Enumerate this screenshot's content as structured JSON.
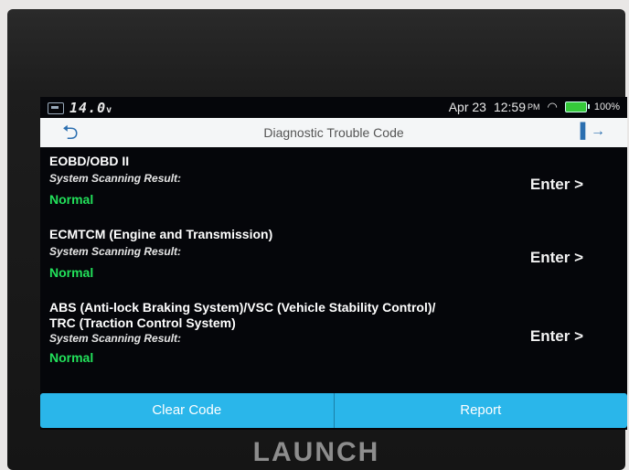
{
  "statusbar": {
    "voltage": "14.0",
    "voltage_unit": "v",
    "date": "Apr 23",
    "time": "12:59",
    "ampm": "PM",
    "battery": "100%"
  },
  "titlebar": {
    "title": "Diagnostic Trouble Code"
  },
  "systems": [
    {
      "name_line1": "EOBD/OBD II",
      "name_line2": "",
      "scan_label": "System Scanning Result:",
      "status": "Normal",
      "enter_label": "Enter >"
    },
    {
      "name_line1": "ECMTCM (Engine and Transmission)",
      "name_line2": "",
      "scan_label": "System Scanning Result:",
      "status": "Normal",
      "enter_label": "Enter >"
    },
    {
      "name_line1": "ABS (Anti-lock Braking System)/VSC (Vehicle Stability Control)/",
      "name_line2": "TRC (Traction Control System)",
      "scan_label": "System Scanning Result:",
      "status": "Normal",
      "enter_label": "Enter >"
    }
  ],
  "actions": {
    "clear_code": "Clear Code",
    "report": "Report"
  },
  "brand": "LAUNCH",
  "colors": {
    "accent": "#2ab6ea",
    "status_normal": "#22e05a",
    "battery": "#35c93a"
  }
}
